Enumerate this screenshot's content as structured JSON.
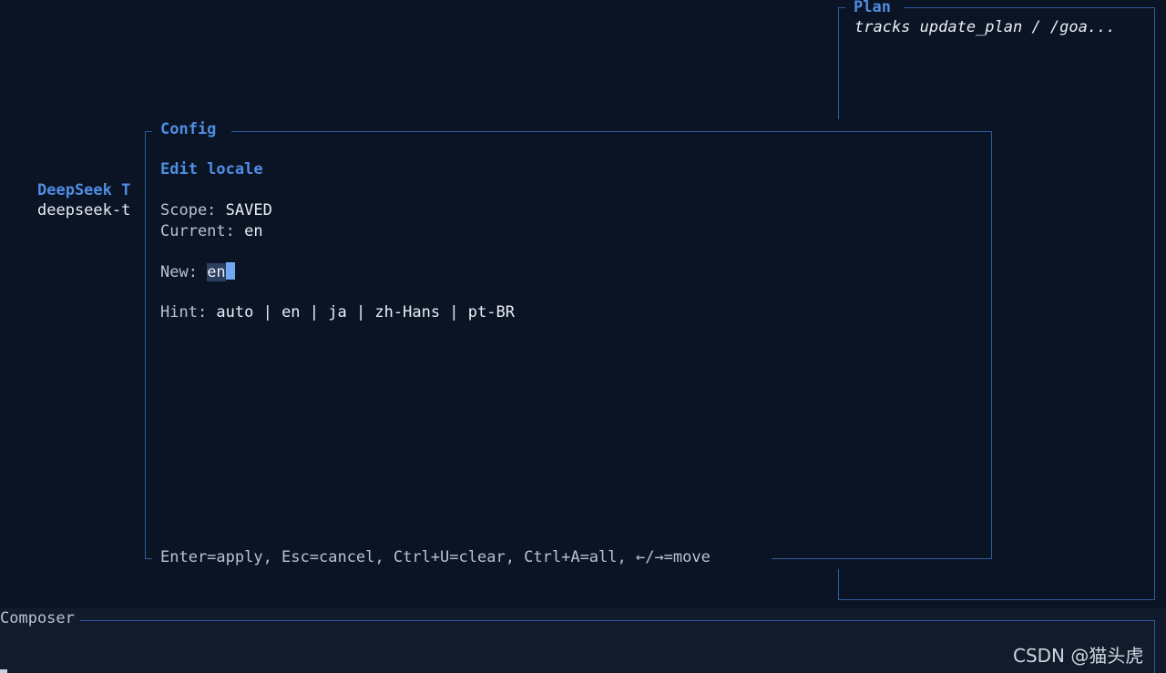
{
  "plan": {
    "title": "Plan",
    "subtitle": "tracks update_plan / /goa..."
  },
  "background": {
    "title": "DeepSeek T",
    "subtitle": "deepseek-t"
  },
  "config": {
    "title": "Config",
    "heading": "Edit locale",
    "scope_label": "Scope: ",
    "scope_value": "SAVED",
    "current_label": "Current: ",
    "current_value": "en",
    "new_label": "New: ",
    "new_value": "en",
    "hint_label": "Hint: ",
    "hint_value": "auto | en | ja | zh-Hans | pt-BR",
    "footer": "Enter=apply, Esc=cancel, Ctrl+U=clear, Ctrl+A=all, ←/→=move"
  },
  "composer": {
    "title": "Composer"
  },
  "watermark": "CSDN @猫头虎",
  "colors": {
    "background": "#0b1424",
    "accent": "#4f8de3",
    "border": "#2f5c9e",
    "cursor": "#6fa8f0"
  }
}
